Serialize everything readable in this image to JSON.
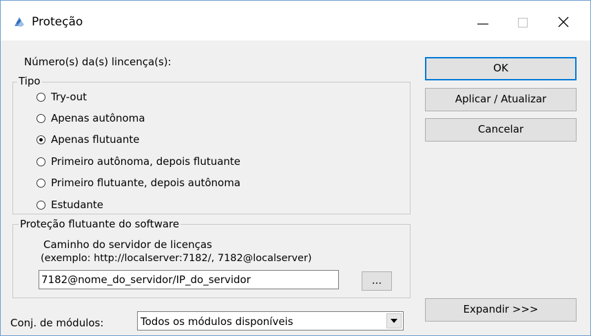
{
  "window": {
    "title": "Proteção",
    "controls": {
      "minimize": "minimize-icon",
      "maximize": "maximize-icon",
      "close": "close-icon"
    }
  },
  "license_numbers_label": "Número(s) da(s) lincença(s):",
  "tipo": {
    "legend": "Tipo",
    "options": [
      {
        "label": "Try-out",
        "checked": false
      },
      {
        "label": "Apenas autônoma",
        "checked": false
      },
      {
        "label": "Apenas flutuante",
        "checked": true
      },
      {
        "label": "Primeiro autônoma, depois flutuante",
        "checked": false
      },
      {
        "label": "Primeiro flutuante, depois autônoma",
        "checked": false
      },
      {
        "label": "Estudante",
        "checked": false
      }
    ]
  },
  "floating": {
    "legend": "Proteção flutuante do software",
    "path_label": "Caminho do servidor de licenças",
    "example_label": "(exemplo: http://localserver:7182/, 7182@localserver)",
    "server_value": "7182@nome_do_servidor/IP_do_servidor",
    "browse_label": "..."
  },
  "modules": {
    "label": "Conj. de módulos:",
    "selected": "Todos os módulos disponíveis"
  },
  "buttons": {
    "ok": "OK",
    "apply": "Aplicar / Atualizar",
    "cancel": "Cancelar",
    "expand": "Expandir >>>"
  },
  "colors": {
    "focus_border": "#0078d7",
    "dialog_bg": "#f0f0f0",
    "title_bg": "#ffffff"
  }
}
